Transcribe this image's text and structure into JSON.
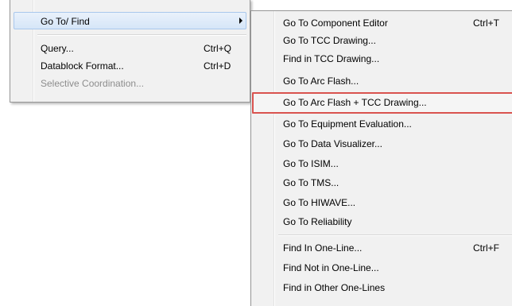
{
  "left_menu": {
    "items": [
      {
        "label": "Go To/ Find"
      },
      {
        "label": "Query...",
        "shortcut": "Ctrl+Q"
      },
      {
        "label": "Datablock Format...",
        "shortcut": "Ctrl+D"
      },
      {
        "label": "Selective Coordination..."
      }
    ]
  },
  "right_menu": {
    "items": [
      {
        "label": "Go To Component Editor",
        "shortcut": "Ctrl+T"
      },
      {
        "label": "Go To TCC Drawing..."
      },
      {
        "label": "Find in TCC Drawing..."
      },
      {
        "label": "Go To Arc Flash..."
      },
      {
        "label": "Go To Arc Flash + TCC Drawing..."
      },
      {
        "label": "Go To Equipment Evaluation..."
      },
      {
        "label": "Go To Data Visualizer..."
      },
      {
        "label": "Go To ISIM..."
      },
      {
        "label": "Go To TMS..."
      },
      {
        "label": "Go To HIWAVE..."
      },
      {
        "label": "Go To Reliability"
      },
      {
        "label": "Find In One-Line...",
        "shortcut": "Ctrl+F"
      },
      {
        "label": "Find Not in One-Line..."
      },
      {
        "label": "Find in Other One-Lines"
      }
    ]
  }
}
